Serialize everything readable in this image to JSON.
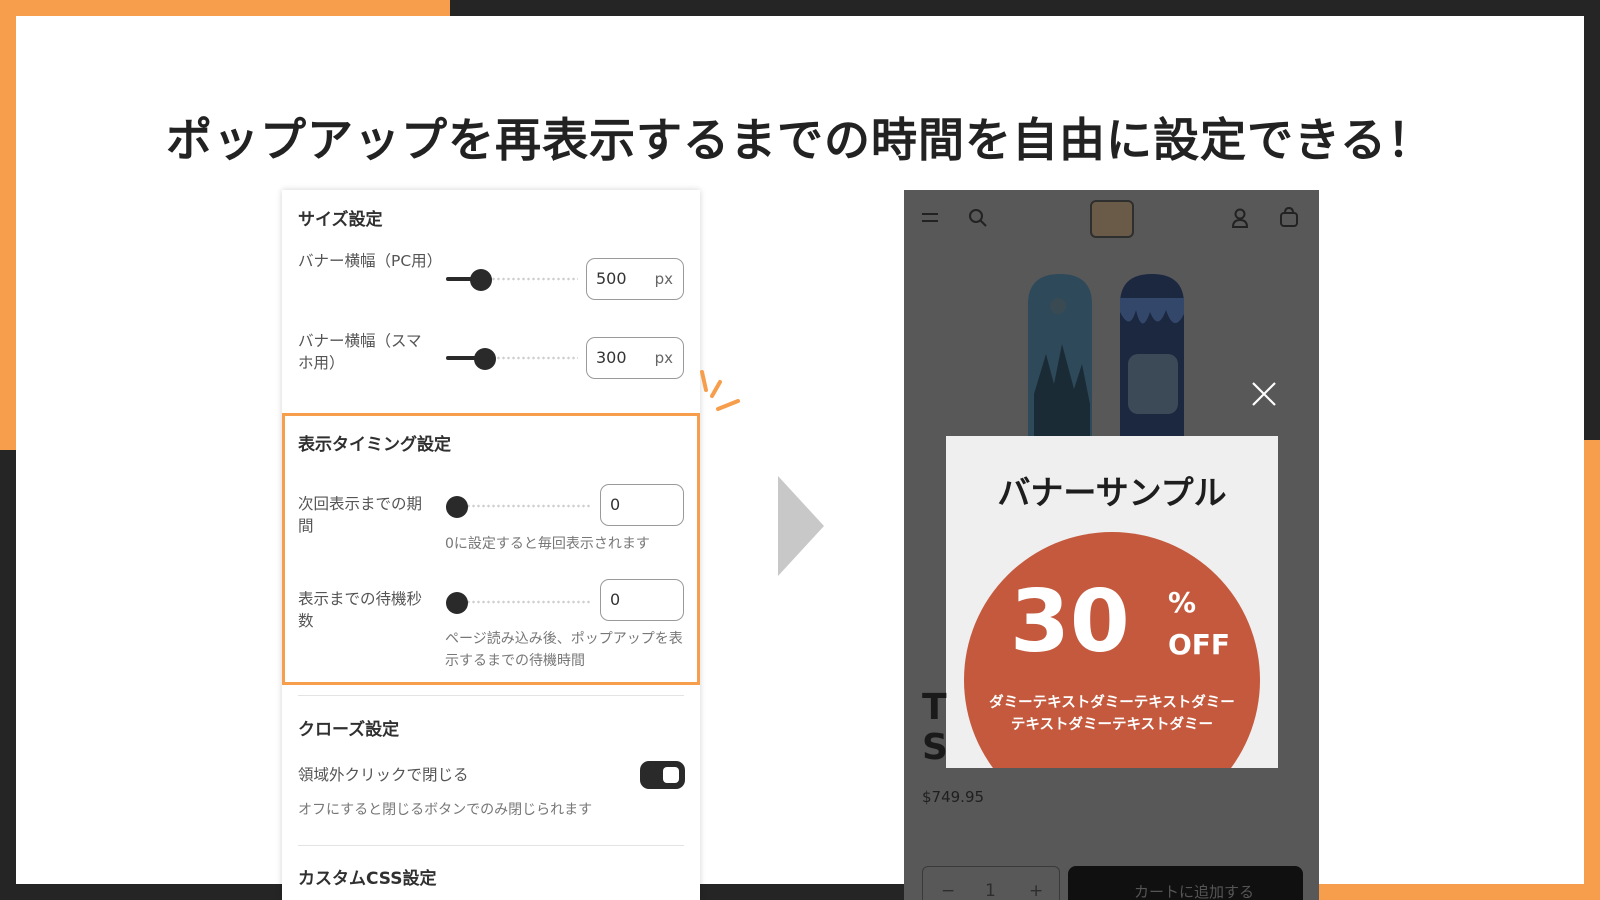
{
  "headline": "ポップアップを再表示するまでの時間を自由に設定できる！",
  "colors": {
    "accent": "#F79E4C",
    "dark_bg": "#252525",
    "banner_circle": "#C4593D"
  },
  "settings": {
    "size": {
      "title": "サイズ設定",
      "pc_width": {
        "label": "バナー横幅（PC用）",
        "value": "500",
        "unit": "px",
        "slider_fraction": 0.25
      },
      "sp_width": {
        "label": "バナー横幅（スマホ用）",
        "value": "300",
        "unit": "px",
        "slider_fraction": 0.28
      }
    },
    "timing": {
      "title": "表示タイミング設定",
      "next_display": {
        "label": "次回表示までの期間",
        "value": "0",
        "help": "0に設定すると毎回表示されます",
        "slider_fraction": 0
      },
      "wait_seconds": {
        "label": "表示までの待機秒数",
        "value": "0",
        "help": "ページ読み込み後、ポップアップを表示するまでの待機時間",
        "slider_fraction": 0
      }
    },
    "close": {
      "title": "クローズ設定",
      "outside_click": {
        "label": "領域外クリックで閉じる",
        "help": "オフにすると閉じるボタンでのみ閉じられます",
        "enabled": true
      }
    },
    "css": {
      "title": "カスタムCSS設定"
    }
  },
  "phone": {
    "icons": [
      "menu-icon",
      "search-icon",
      "store-logo",
      "account-icon",
      "cart-icon"
    ],
    "product_title_fragment": "T\nS",
    "price": "$749.95",
    "quantity": "1",
    "qty_minus": "−",
    "qty_plus": "+",
    "add_to_cart": "カートに追加する",
    "banner": {
      "title": "バナーサンプル",
      "discount_number": "30",
      "percent": "%",
      "off": "OFF",
      "dummy_text": "ダミーテキストダミーテキストダミー\nテキストダミーテキストダミー"
    }
  }
}
